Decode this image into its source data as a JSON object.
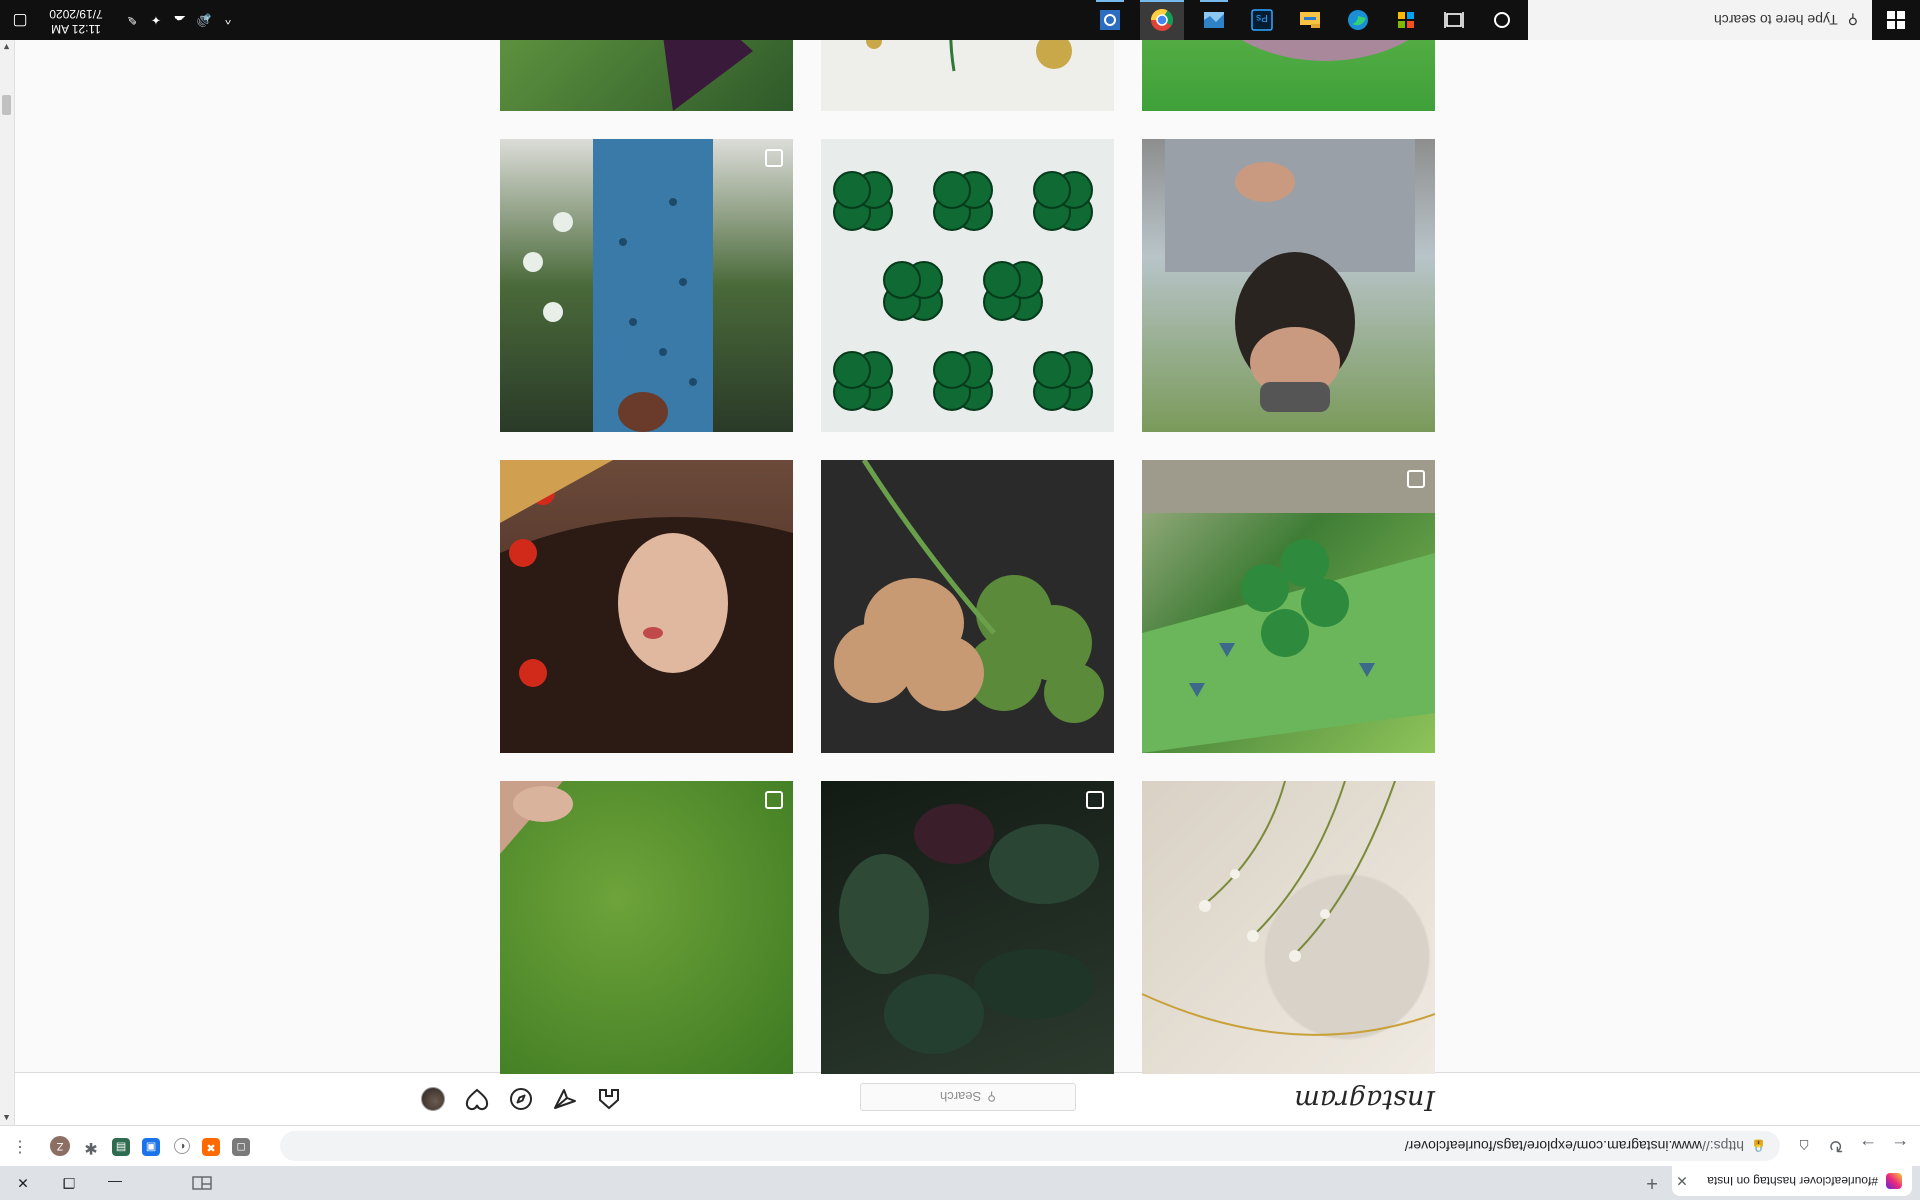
{
  "browser": {
    "tab_title": "#fourleafclover hashtag on Insta",
    "address_scheme": "https://",
    "address_rest": "www.instagram.com/explore/tags/fourleafclover/",
    "profile_initial": "Z"
  },
  "instagram": {
    "logo": "Instagram",
    "search_placeholder": "Search"
  },
  "taskbar": {
    "search_placeholder": "Type here to search",
    "time": "11:21 AM",
    "date": "7/19/2020"
  },
  "posts": [
    {
      "row": 0,
      "col": 0,
      "subject": "wildflowers on cream fabric",
      "multi": false
    },
    {
      "row": 0,
      "col": 1,
      "subject": "dark leaf plant",
      "multi": true
    },
    {
      "row": 0,
      "col": 2,
      "subject": "hand on green grass",
      "multi": true
    },
    {
      "row": 1,
      "col": 0,
      "subject": "clover on wet stone sign",
      "multi": true
    },
    {
      "row": 1,
      "col": 1,
      "subject": "green and tan clover leaves",
      "multi": false
    },
    {
      "row": 1,
      "col": 2,
      "subject": "woman with red flowers",
      "multi": false
    },
    {
      "row": 2,
      "col": 0,
      "subject": "man holding clover",
      "multi": false
    },
    {
      "row": 2,
      "col": 1,
      "subject": "green clover beads",
      "multi": false
    },
    {
      "row": 2,
      "col": 2,
      "subject": "woman in blue dress",
      "multi": true
    },
    {
      "row": 3,
      "col": 0,
      "subject": "hand holding clover over grass",
      "multi": false
    },
    {
      "row": 3,
      "col": 1,
      "subject": "clover on cracked paint",
      "multi": false
    },
    {
      "row": 3,
      "col": 2,
      "subject": "purple and green leaves with dew",
      "multi": false
    }
  ],
  "colors": {
    "taskbar": "#101010",
    "tabstrip": "#dee1e6",
    "page_bg": "#fafafa"
  }
}
